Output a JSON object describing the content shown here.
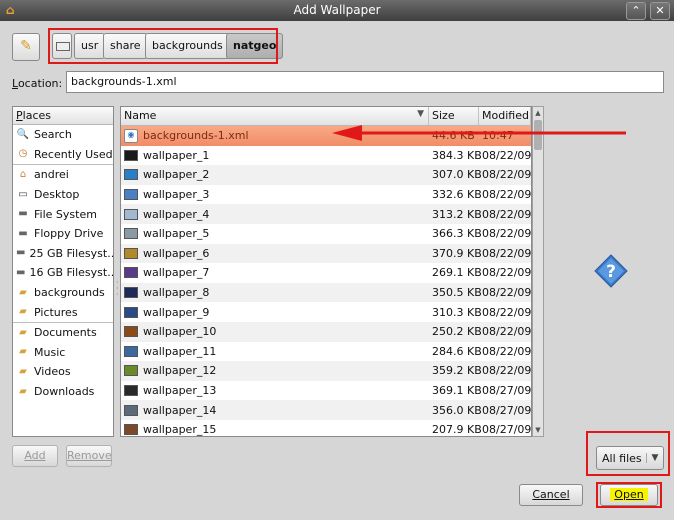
{
  "window": {
    "title": "Add Wallpaper"
  },
  "path_bar": {
    "segments": [
      "usr",
      "share",
      "backgrounds",
      "natgeo"
    ],
    "active": "natgeo"
  },
  "location": {
    "label": "Location:",
    "value": "backgrounds-1.xml"
  },
  "places": {
    "header": "Places",
    "items": [
      {
        "label": "Search",
        "icon": "search-icon"
      },
      {
        "label": "Recently Used",
        "icon": "clock-icon"
      },
      {
        "label": "andrei",
        "icon": "home-folder-icon"
      },
      {
        "label": "Desktop",
        "icon": "desktop-icon"
      },
      {
        "label": "File System",
        "icon": "drive-icon"
      },
      {
        "label": "Floppy Drive",
        "icon": "floppy-icon"
      },
      {
        "label": "25 GB Filesyst...",
        "icon": "drive-icon"
      },
      {
        "label": "16 GB Filesyst...",
        "icon": "drive-icon"
      },
      {
        "label": "backgrounds",
        "icon": "folder-icon"
      },
      {
        "label": "Pictures",
        "icon": "folder-icon"
      },
      {
        "label": "Documents",
        "icon": "folder-icon"
      },
      {
        "label": "Music",
        "icon": "folder-icon"
      },
      {
        "label": "Videos",
        "icon": "folder-icon"
      },
      {
        "label": "Downloads",
        "icon": "folder-icon"
      }
    ]
  },
  "files": {
    "columns": {
      "name": "Name",
      "size": "Size",
      "modified": "Modified"
    },
    "rows": [
      {
        "name": "backgrounds-1.xml",
        "size": "44.6 KB",
        "modified": "10:47",
        "selected": true,
        "color": ""
      },
      {
        "name": "wallpaper_1",
        "size": "384.3 KB",
        "modified": "08/22/09",
        "color": "#1a1a1a"
      },
      {
        "name": "wallpaper_2",
        "size": "307.0 KB",
        "modified": "08/22/09",
        "color": "#2a7ec8"
      },
      {
        "name": "wallpaper_3",
        "size": "332.6 KB",
        "modified": "08/22/09",
        "color": "#4a80c4"
      },
      {
        "name": "wallpaper_4",
        "size": "313.2 KB",
        "modified": "08/22/09",
        "color": "#a0b8d0"
      },
      {
        "name": "wallpaper_5",
        "size": "366.3 KB",
        "modified": "08/22/09",
        "color": "#8a9aa4"
      },
      {
        "name": "wallpaper_6",
        "size": "370.9 KB",
        "modified": "08/22/09",
        "color": "#b08a2a"
      },
      {
        "name": "wallpaper_7",
        "size": "269.1 KB",
        "modified": "08/22/09",
        "color": "#5a3a8a"
      },
      {
        "name": "wallpaper_8",
        "size": "350.5 KB",
        "modified": "08/22/09",
        "color": "#1c2c5a"
      },
      {
        "name": "wallpaper_9",
        "size": "310.3 KB",
        "modified": "08/22/09",
        "color": "#2a4a8a"
      },
      {
        "name": "wallpaper_10",
        "size": "250.2 KB",
        "modified": "08/22/09",
        "color": "#8a4a1a"
      },
      {
        "name": "wallpaper_11",
        "size": "284.6 KB",
        "modified": "08/22/09",
        "color": "#3a6aa0"
      },
      {
        "name": "wallpaper_12",
        "size": "359.2 KB",
        "modified": "08/22/09",
        "color": "#6a8a2a"
      },
      {
        "name": "wallpaper_13",
        "size": "369.1 KB",
        "modified": "08/27/09",
        "color": "#2a2a2a"
      },
      {
        "name": "wallpaper_14",
        "size": "356.0 KB",
        "modified": "08/27/09",
        "color": "#5a6a7a"
      },
      {
        "name": "wallpaper_15",
        "size": "207.9 KB",
        "modified": "08/27/09",
        "color": "#7a4a2a"
      }
    ]
  },
  "buttons": {
    "add": "Add",
    "remove": "Remove",
    "cancel": "Cancel",
    "open": "Open"
  },
  "filter": {
    "value": "All files"
  },
  "colors": {
    "highlight_red": "#e01818",
    "selection": "#f18d67",
    "open_highlight": "#f7f200"
  }
}
